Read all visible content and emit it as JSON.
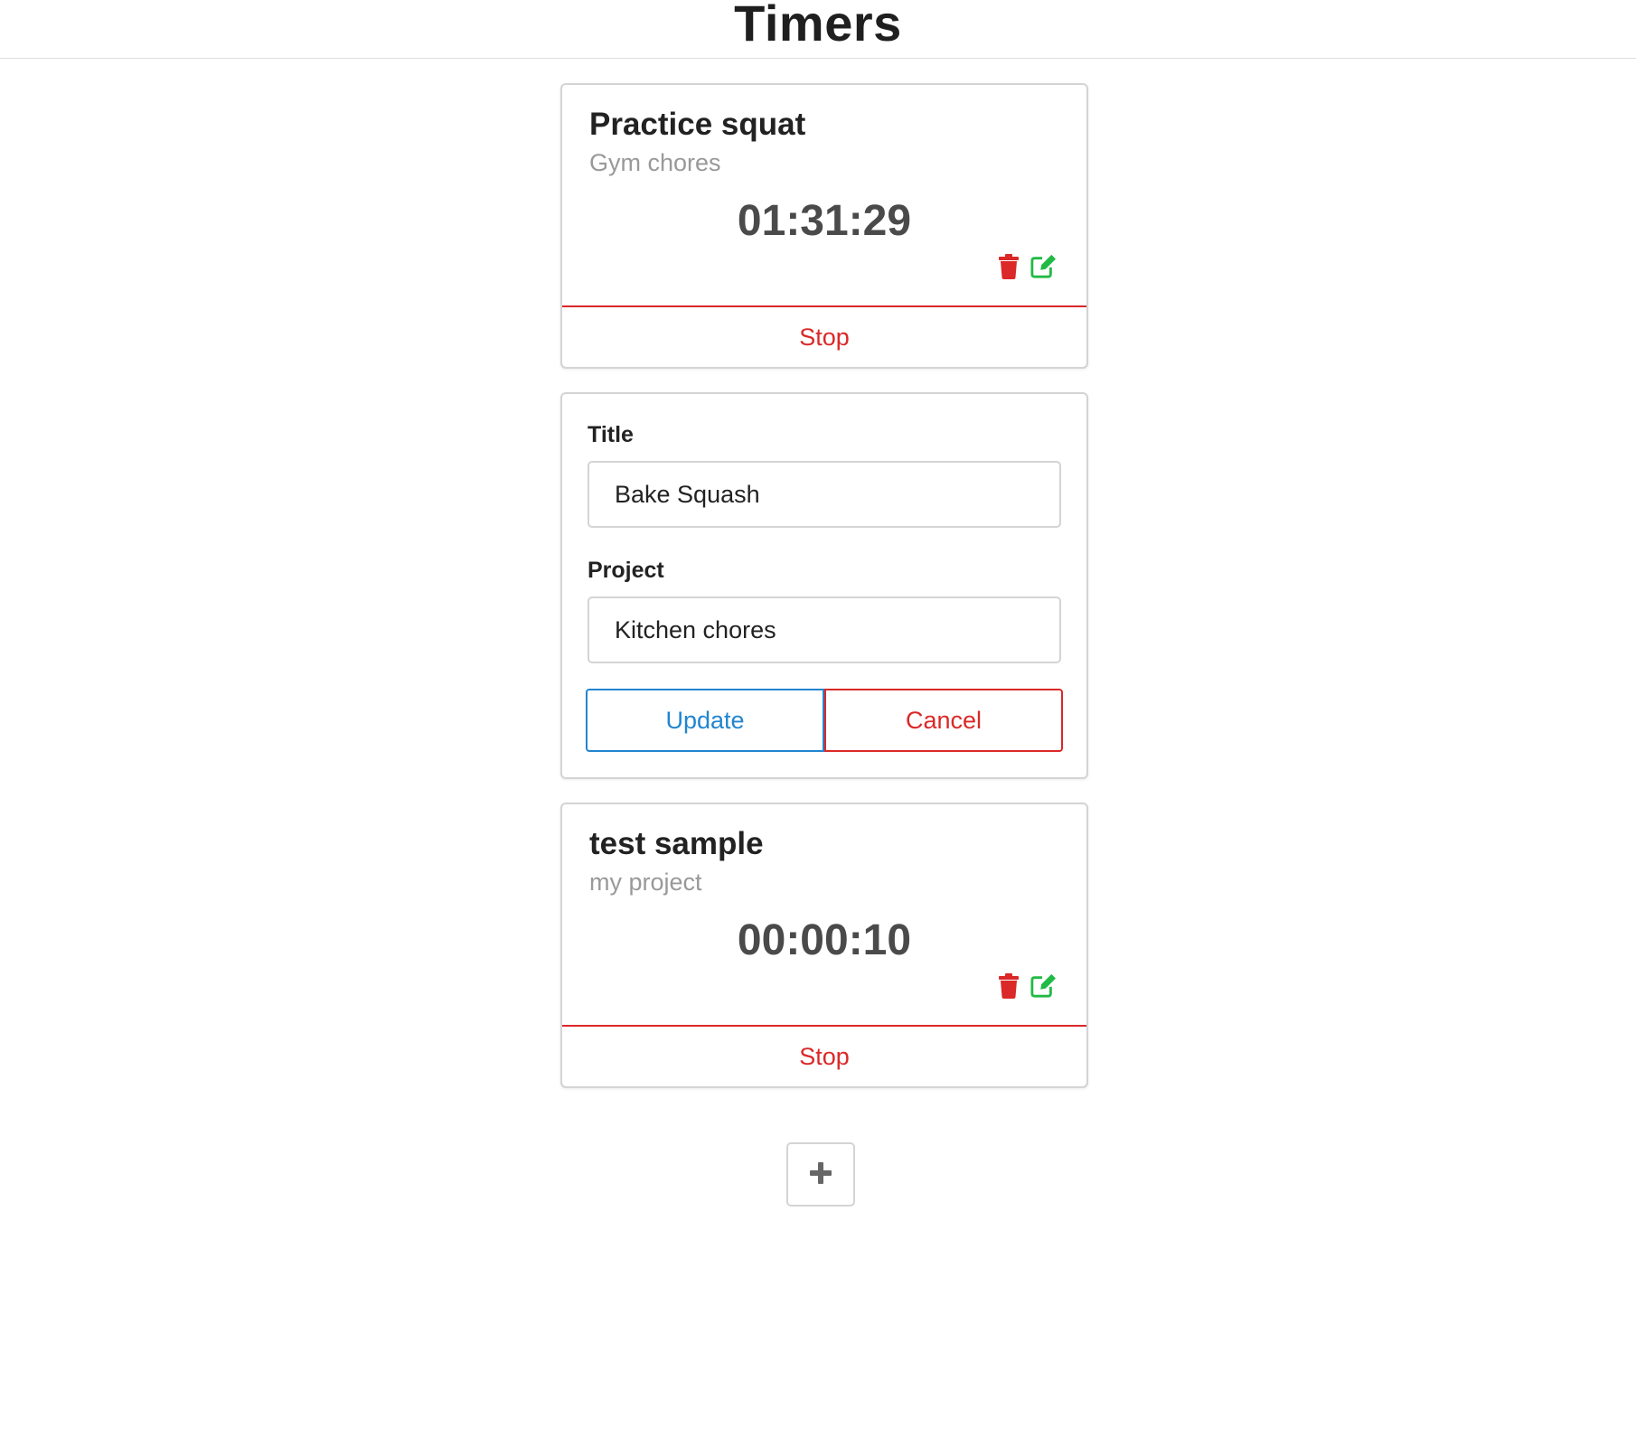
{
  "page": {
    "title": "Timers"
  },
  "timers": [
    {
      "title": "Practice squat",
      "project": "Gym chores",
      "elapsed": "01:31:29",
      "stop_label": "Stop"
    },
    {
      "title": "test sample",
      "project": "my project",
      "elapsed": "00:00:10",
      "stop_label": "Stop"
    }
  ],
  "edit_form": {
    "title_label": "Title",
    "title_value": "Bake Squash",
    "project_label": "Project",
    "project_value": "Kitchen chores",
    "update_label": "Update",
    "cancel_label": "Cancel"
  },
  "icons": {
    "delete": "trash-icon",
    "edit": "edit-icon",
    "add": "plus-icon"
  },
  "colors": {
    "danger": "#db2828",
    "primary": "#2185d0",
    "success": "#21ba45",
    "elapsed_text": "#4a4a4a",
    "muted_text": "#999999"
  }
}
